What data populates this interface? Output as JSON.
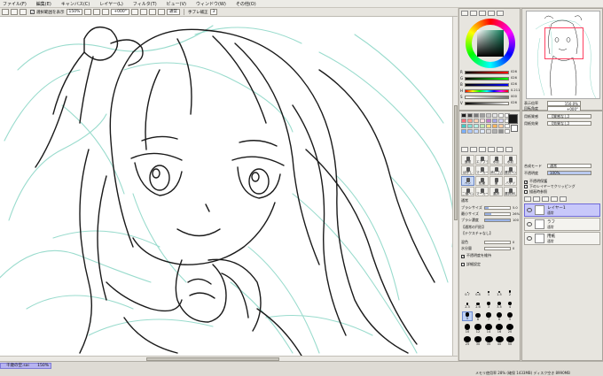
{
  "menu": [
    "ファイル(F)",
    "編集(E)",
    "キャンバス(C)",
    "レイヤー(L)",
    "フィルタ(T)",
    "ビュー(V)",
    "ウィンドウ(W)",
    "その他(O)"
  ],
  "toolbar": {
    "selection_check_label": "選択範囲を表示",
    "zoom_value": "150%",
    "rotate_value": "+000°",
    "mode_value": "通常",
    "stabilizer_label": "手ブレ補正",
    "stabilizer_value": "3"
  },
  "color_panel": {
    "sliders": [
      {
        "label": "R",
        "value": "026"
      },
      {
        "label": "G",
        "value": "026"
      },
      {
        "label": "B",
        "value": "026"
      },
      {
        "label": "H",
        "value": "0.211"
      },
      {
        "label": "S",
        "value": "000"
      },
      {
        "label": "V",
        "value": "026"
      }
    ],
    "swatches": [
      "#1e1e1e",
      "#4a4a4a",
      "#7a7a7a",
      "#a0a0a0",
      "#c8c8c8",
      "#e6e6e6",
      "#ffffff",
      "#ffffff",
      "#ff6d7a",
      "#f7a08c",
      "#ffd1b3",
      "#ffe0e0",
      "#c37ccf",
      "#a5a8e8",
      "#d7d7f7",
      "#ffffff",
      "#46c9c3",
      "#83e0d5",
      "#b8f0e6",
      "#c0ecb2",
      "#ffe08a",
      "#f8b55f",
      "#ffd0a8",
      "#ffffff",
      "#7ab0ff",
      "#a9c6ff",
      "#c9dcff",
      "#e1ecff",
      "#d8d8d8",
      "#b0b0b0",
      "#909090",
      "#ffffff"
    ]
  },
  "tools": {
    "row1": [
      "通常",
      "エアブラシ",
      "水彩",
      "水彩"
    ],
    "row2": [
      "ぼかし",
      "マーカー",
      "消しゴム",
      "選択ペン"
    ],
    "row3": [
      "ペン",
      "鉛筆",
      "筆",
      "バケツ"
    ],
    "row4": [
      "二値ペン",
      "マーカー",
      "選択",
      "選択消し"
    ]
  },
  "brush": {
    "mode": "通常",
    "size_label": "ブラシサイズ",
    "size_mult": "×1.0",
    "size_value": "5.0",
    "min_size_label": "最小サイズ",
    "min_size_value": "26%",
    "density_label": "ブラシ濃度",
    "density_value": "100",
    "shape_label": "【通常の円形】",
    "texture_label": "【テクスチャなし】",
    "blend_label": "混色",
    "blend_value": "0",
    "water_label": "水分量",
    "water_value": "0",
    "keep_opacity_label": "不透明度を維持",
    "stability_label": "詳細設定",
    "sizes": [
      "0.7",
      "0.8",
      "1",
      "1.5",
      "2",
      "2.3",
      "2.6",
      "3",
      "3.5",
      "4",
      "5",
      "6",
      "7",
      "8",
      "9",
      "10",
      "12",
      "14",
      "16",
      "20",
      "25",
      "30",
      "35",
      "40",
      "50"
    ],
    "selected_size": "5"
  },
  "navigator": {
    "zoom_label": "表示倍率",
    "zoom_value": "150.0%",
    "rotate_label": "回転角度",
    "rotate_value": "+000°"
  },
  "layer_panel": {
    "paper_label": "用紙質感",
    "paper_value": "【質感なし】",
    "effect_label": "用紙効果",
    "effect_value": "【効果なし】",
    "mode_label": "合成モード",
    "mode_value": "通常",
    "opacity_label": "不透明度",
    "opacity_value": "100%",
    "protect_label": "不透明保護",
    "clip_label": "下のレイヤーでクリッピング",
    "ref_label": "描画時参照",
    "select_label": "選択ソース",
    "layers": [
      {
        "name": "レイヤー1",
        "mode": "通常",
        "selected": true
      },
      {
        "name": "ラフ",
        "mode": "通常",
        "selected": false
      },
      {
        "name": "用紙",
        "mode": "通常",
        "selected": false
      }
    ]
  },
  "status": {
    "doc_name": "千歳の空.sai",
    "doc_zoom": "150%",
    "memory": "メモリ使用率 28% (確保 1433MB) ディスク空き 8990MB"
  },
  "colors": {
    "sketch_line": "#8fd8c8",
    "ink_line": "#1a1a1a",
    "doc_tab": "#b6b3f0",
    "layer_selected": "#c8c8fa"
  }
}
